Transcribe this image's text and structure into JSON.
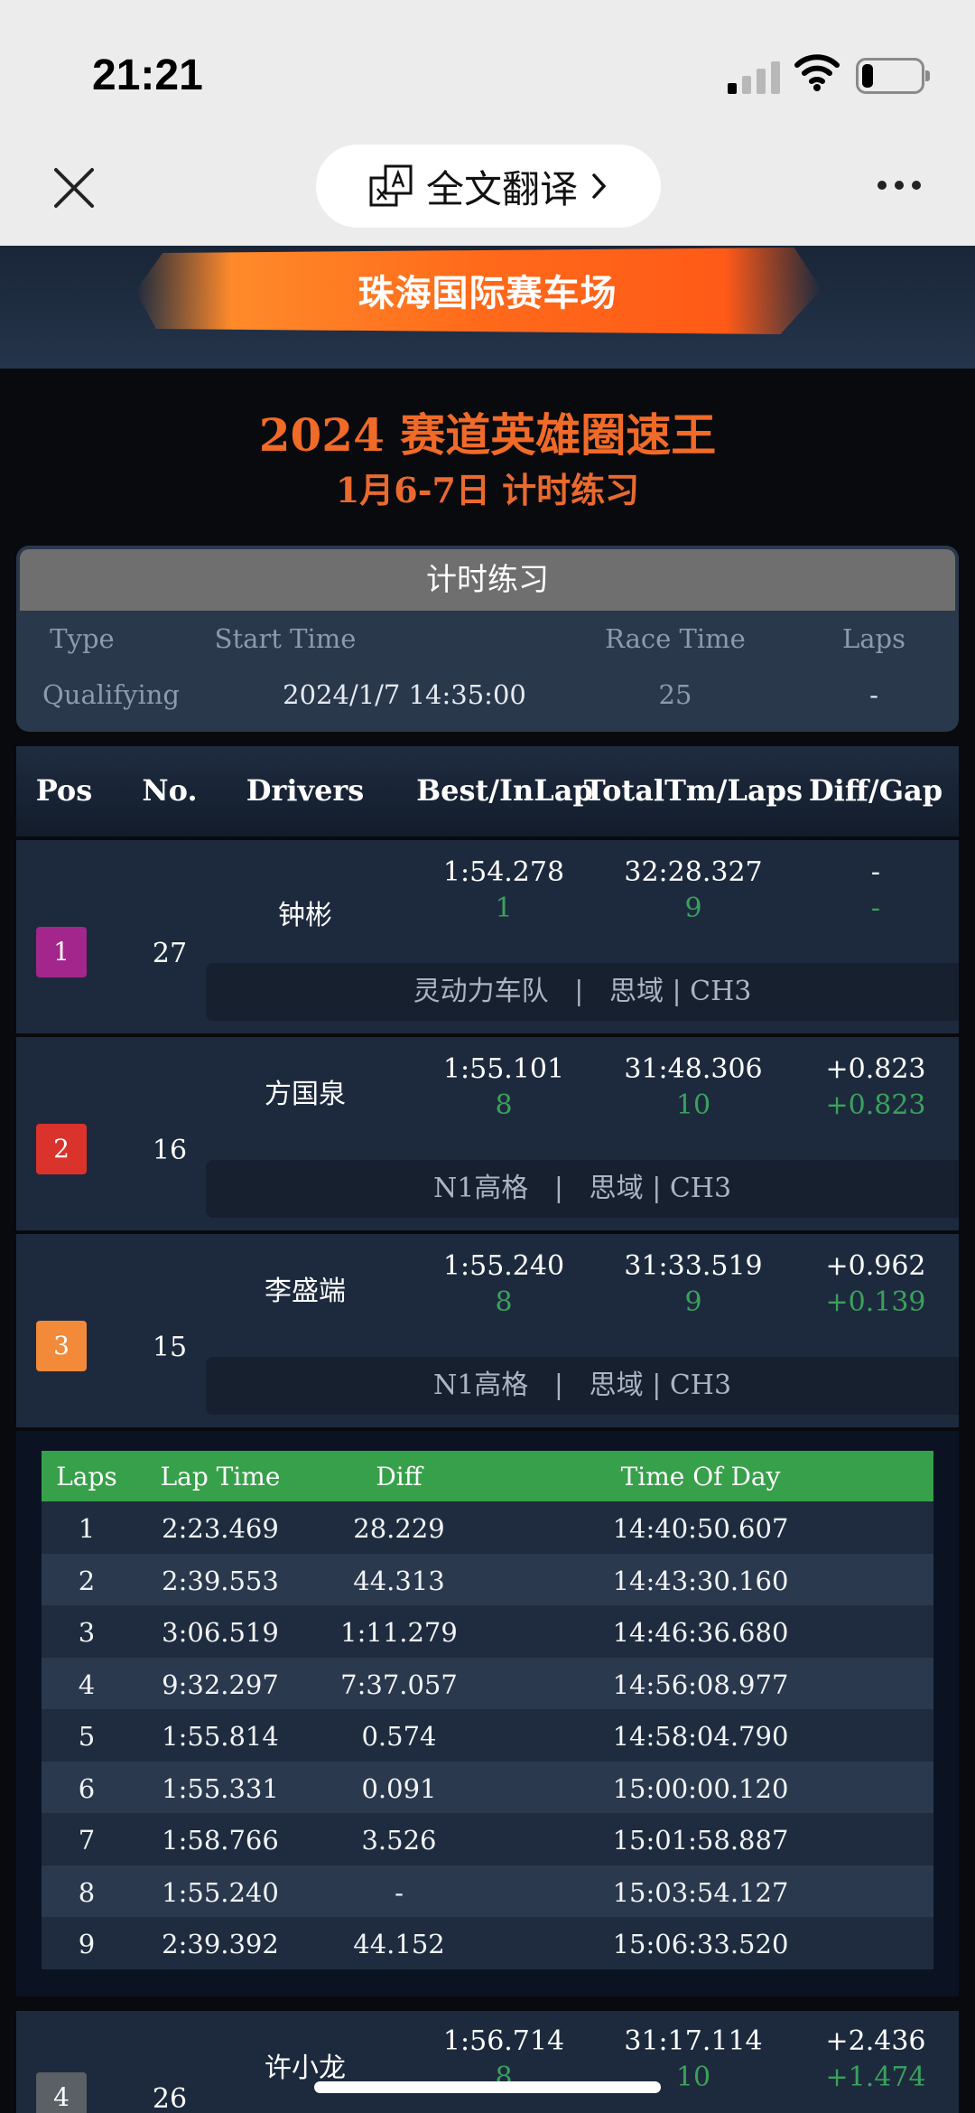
{
  "status": {
    "time": "21:21"
  },
  "toolbar": {
    "translate_label": "全文翻译"
  },
  "banner": {
    "venue": "珠海国际赛车场"
  },
  "headline": {
    "title": "2024 赛道英雄圈速王",
    "subtitle": "1月6-7日 计时练习"
  },
  "session": {
    "title": "计时练习",
    "headers": [
      "Type",
      "Start Time",
      "Race Time",
      "Laps"
    ],
    "values": [
      "Qualifying",
      "2024/1/7 14:35:00",
      "25",
      "-"
    ]
  },
  "results": {
    "headers": [
      "Pos",
      "No.",
      "Drivers",
      "Best/InLap",
      "TotalTm/Laps",
      "Diff/Gap"
    ],
    "rows": [
      {
        "pos": "1",
        "badge_color": "#a3268c",
        "no": "27",
        "driver": "钟彬",
        "best": "1:54.278",
        "inlap": "1",
        "total": "32:28.327",
        "laps": "9",
        "diff": "-",
        "gap": "-",
        "team": "灵动力车队",
        "car": "思域 | CH3"
      },
      {
        "pos": "2",
        "badge_color": "#d9332b",
        "no": "16",
        "driver": "方国泉",
        "best": "1:55.101",
        "inlap": "8",
        "total": "31:48.306",
        "laps": "10",
        "diff": "+0.823",
        "gap": "+0.823",
        "team": "N1高格",
        "car": "思域 | CH3"
      },
      {
        "pos": "3",
        "badge_color": "#f28a3a",
        "no": "15",
        "driver": "李盛端",
        "best": "1:55.240",
        "inlap": "8",
        "total": "31:33.519",
        "laps": "9",
        "diff": "+0.962",
        "gap": "+0.139",
        "team": "N1高格",
        "car": "思域 | CH3"
      },
      {
        "pos": "4",
        "badge_color": "#5b5f66",
        "no": "26",
        "driver": "许小龙",
        "best": "1:56.714",
        "inlap": "8",
        "total": "31:17.114",
        "laps": "10",
        "diff": "+2.436",
        "gap": "+1.474"
      }
    ]
  },
  "laps": {
    "headers": [
      "Laps",
      "Lap Time",
      "Diff",
      "Time Of Day"
    ],
    "header_color": "#37a04a",
    "rows": [
      [
        "1",
        "2:23.469",
        "28.229",
        "14:40:50.607"
      ],
      [
        "2",
        "2:39.553",
        "44.313",
        "14:43:30.160"
      ],
      [
        "3",
        "3:06.519",
        "1:11.279",
        "14:46:36.680"
      ],
      [
        "4",
        "9:32.297",
        "7:37.057",
        "14:56:08.977"
      ],
      [
        "5",
        "1:55.814",
        "0.574",
        "14:58:04.790"
      ],
      [
        "6",
        "1:55.331",
        "0.091",
        "15:00:00.120"
      ],
      [
        "7",
        "1:58.766",
        "3.526",
        "15:01:58.887"
      ],
      [
        "8",
        "1:55.240",
        "-",
        "15:03:54.127"
      ],
      [
        "9",
        "2:39.392",
        "44.152",
        "15:06:33.520"
      ]
    ]
  }
}
